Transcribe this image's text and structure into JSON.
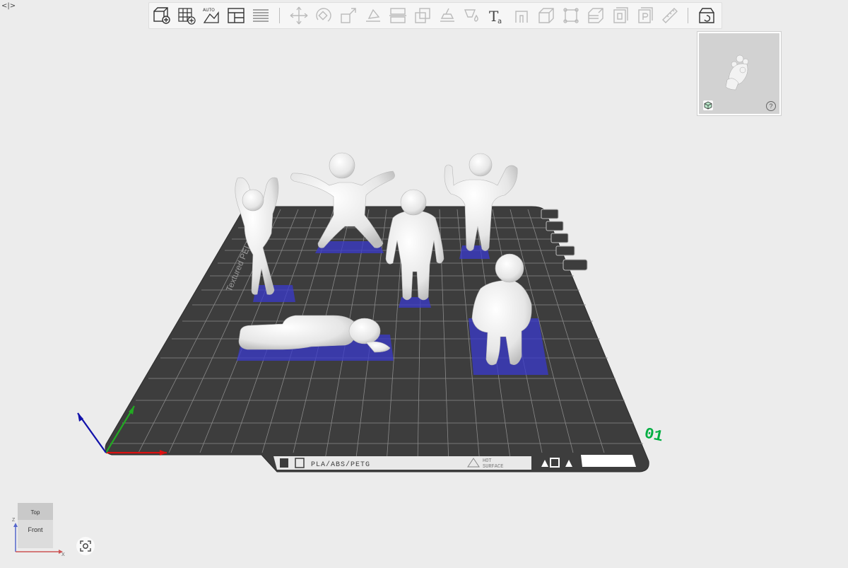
{
  "toolbar": {
    "buttons": [
      {
        "name": "add-icon",
        "enabled": true
      },
      {
        "name": "add-plate-icon",
        "enabled": true
      },
      {
        "name": "auto-arrange-icon",
        "enabled": true,
        "text": "AUTO"
      },
      {
        "name": "plate-layout-icon",
        "enabled": true
      },
      {
        "name": "split-layers-icon",
        "enabled": true
      },
      {
        "name": "move-icon",
        "enabled": false
      },
      {
        "name": "rotate-icon",
        "enabled": false
      },
      {
        "name": "scale-icon",
        "enabled": false
      },
      {
        "name": "lay-on-face-icon",
        "enabled": false
      },
      {
        "name": "cut-icon",
        "enabled": false
      },
      {
        "name": "boolean-icon",
        "enabled": false
      },
      {
        "name": "support-paint-icon",
        "enabled": false
      },
      {
        "name": "color-paint-icon",
        "enabled": false
      },
      {
        "name": "text-emboss-icon",
        "enabled": false
      },
      {
        "name": "seam-paint-icon",
        "enabled": false
      },
      {
        "name": "shell-icon",
        "enabled": false
      },
      {
        "name": "measure-icon",
        "enabled": false
      },
      {
        "name": "variable-layer-icon",
        "enabled": false
      },
      {
        "name": "hollow-icon",
        "enabled": false
      },
      {
        "name": "part-settings-icon",
        "enabled": false
      },
      {
        "name": "ruler-icon",
        "enabled": false
      },
      {
        "name": "assembly-view-icon",
        "enabled": true
      }
    ]
  },
  "thumbnail": {
    "help_glyph": "?"
  },
  "plate": {
    "label": "Textured PEI Plate",
    "material_label": "PLA/ABS/PETG",
    "hot_surface_line1": "HOT",
    "hot_surface_line2": "SURFACE",
    "plate_number": "01"
  },
  "view_cube": {
    "top_label": "Top",
    "front_label": "Front",
    "axis_x": "X",
    "axis_z": "Z"
  },
  "colors": {
    "accent_green": "#00ae42",
    "support_blue": "#3a3acc",
    "axis_x": "#dd1111",
    "axis_y": "#22aa22",
    "axis_z": "#1111aa"
  }
}
